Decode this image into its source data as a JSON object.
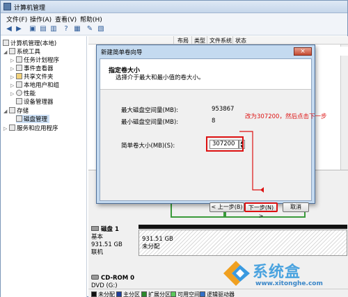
{
  "window": {
    "title": "计算机管理"
  },
  "menu": {
    "items": [
      "文件(F)",
      "操作(A)",
      "查看(V)",
      "帮助(H)"
    ]
  },
  "tree": {
    "root": "计算机管理(本地)",
    "system_tools": "系统工具",
    "task_scheduler": "任务计划程序",
    "event_viewer": "事件查看器",
    "shared_folders": "共享文件夹",
    "local_users": "本地用户和组",
    "performance": "性能",
    "device_manager": "设备管理器",
    "storage": "存储",
    "disk_management": "磁盘管理",
    "services_apps": "服务和应用程序"
  },
  "columns": [
    "布局",
    "类型",
    "文件系统",
    "状态"
  ],
  "disks": {
    "disk1": {
      "name": "磁盘 1",
      "type": "基本",
      "size": "931.51 GB",
      "status": "联机",
      "part_size": "931.51 GB",
      "part_status": "未分配"
    },
    "cdrom": {
      "name": "CD-ROM 0",
      "drive": "DVD (G:)"
    }
  },
  "legend": {
    "items": [
      "未分配",
      "主分区",
      "扩展分区",
      "可用空间",
      "逻辑驱动器"
    ]
  },
  "wizard": {
    "title": "新建简单卷向导",
    "close": "×",
    "heading": "指定卷大小",
    "subheading": "选择介于最大和最小值的卷大小。",
    "max_label": "最大磁盘空间量(MB):",
    "max_value": "953867",
    "min_label": "最小磁盘空间量(MB):",
    "min_value": "8",
    "size_label": "简单卷大小(MB)(S):",
    "size_value": "307200",
    "back_label": "< 上一步(B)",
    "next_label": "下一步(N) >",
    "cancel_label": "取消"
  },
  "annotation": {
    "text": "改为307200，然后点击下一步"
  },
  "watermark": {
    "name": "系统盒",
    "url": "www.xitonghe.com"
  },
  "colors": {
    "annotation_red": "#dd1111",
    "title_blue": "#c4daf0",
    "watermark_blue": "#4aa3df"
  }
}
